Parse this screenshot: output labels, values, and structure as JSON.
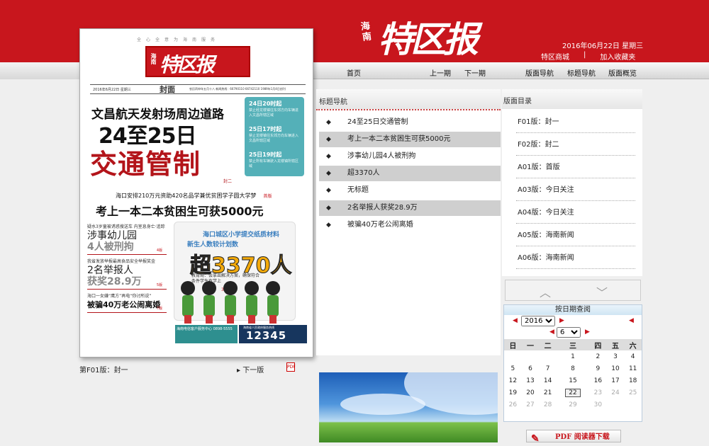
{
  "masthead": {
    "small": "海南",
    "big": "特区报",
    "date": "2016年06月22日  星期三"
  },
  "top_links": [
    "特区商城",
    "|",
    "加入收藏夹"
  ],
  "nav": {
    "home": "首页",
    "prev_issue": "上一期",
    "next_issue": "下一期",
    "edition_nav": "版面导航",
    "title_nav": "标题导航",
    "edition_overview": "版面概览"
  },
  "paper": {
    "slogan": "全心全意为海南服务",
    "logo_small": "海南",
    "logo_big": "特区报",
    "dateline_left": "2016年6月22日  星期三",
    "edition": "封面",
    "dateline_right": "农历丙申年五月十八   新闻热线：66790110  66742110        1989年1月4日创刊",
    "hl1": "文昌航天发射场周边道路",
    "hl2": "24至25日",
    "hl3": "交通管制",
    "teal": [
      {
        "t": "24日20时起",
        "d": "禁止经龙楼镇往东郊方向车辆进入文昌所辖区域"
      },
      {
        "t": "25日17时起",
        "d": "禁止龙楼镇往东郊方向车辆进入文昌所辖区域"
      },
      {
        "t": "25日19时起",
        "d": "禁止所有车辆驶入龙楼镇所辖区域"
      }
    ],
    "fengmian_tag": "封二",
    "sub1": "海口安排210万元资助420名品学兼优贫困学子圆大学梦",
    "sub1_tag": "首版",
    "sub2": "考上一本二本贫困生可获5000元",
    "stories": [
      {
        "k": "疑水3岁童被诱惑搜送车 内室息身亡·追踪",
        "h": "涉事幼儿园",
        "hb": "4人被刑拘",
        "pg": "4版"
      },
      {
        "k": "我省发放举报最高食品安全举报奖金",
        "h": "2名举报人",
        "hb": "获奖28.9万",
        "pg": "5版"
      },
      {
        "k": "海口一女嫌“鹰方”再电“你讨所说”",
        "h": "",
        "hb": "被骗40万老公闹离婚",
        "pg": "7版"
      }
    ],
    "scroll": {
      "t1": "海口城区小学提交纸质材料",
      "t2": "新生人数较计划数",
      "big": "超3370人",
      "cap": "教育局：会拿出解决方案，确保符合条件学生有学上",
      "pg": "3版"
    },
    "ad1": "海南电信客户服务中心 0898-5555",
    "ad2_small": "海南省人民政府服务热线",
    "ad2_num": "12345"
  },
  "paper_footer": {
    "current": "第F01版：封一",
    "next": "下一版",
    "pdf": "PDF"
  },
  "title_nav": {
    "header": "标题导航",
    "items": [
      "24至25日交通管制",
      "考上一本二本贫困生可获5000元",
      "涉事幼儿园4人被刑拘",
      "超3370人",
      "无标题",
      "2名举报人获奖28.9万",
      "被骗40万老公闹离婚"
    ]
  },
  "edition_list": {
    "header": "版面目录",
    "items": [
      "F01版：封一",
      "F02版：封二",
      "A01版：首版",
      "A03版：今日关注",
      "A04版：今日关注",
      "A05版：海南新闻",
      "A06版：海南新闻"
    ]
  },
  "calendar": {
    "header": "按日期查阅",
    "year": "2016",
    "month": "6",
    "weekdays": [
      "日",
      "一",
      "二",
      "三",
      "四",
      "五",
      "六"
    ],
    "weeks": [
      [
        "",
        "",
        "",
        "1",
        "2",
        "3",
        "4"
      ],
      [
        "5",
        "6",
        "7",
        "8",
        "9",
        "10",
        "11"
      ],
      [
        "12",
        "13",
        "14",
        "15",
        "16",
        "17",
        "18"
      ],
      [
        "19",
        "20",
        "21",
        "22",
        "23",
        "24",
        "25"
      ],
      [
        "26",
        "27",
        "28",
        "29",
        "30",
        "",
        ""
      ]
    ],
    "today": "22"
  },
  "pdf_reader": "PDF 阅读器下载"
}
